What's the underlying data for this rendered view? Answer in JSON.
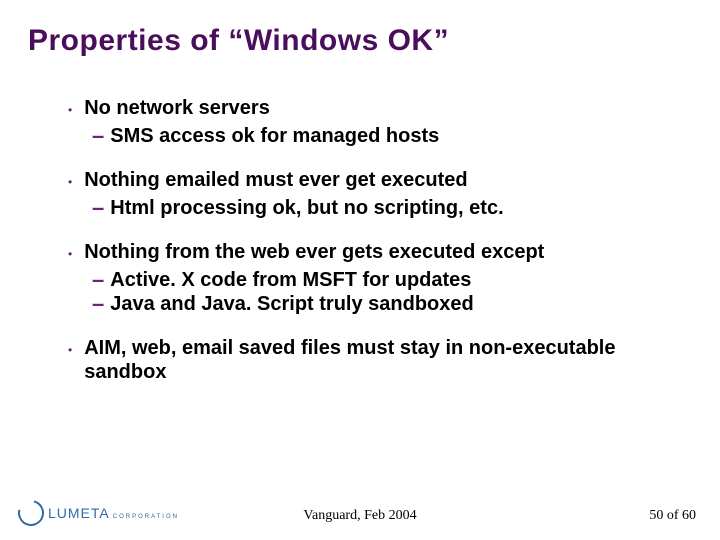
{
  "title": "Properties of “Windows OK”",
  "bullets": [
    {
      "text": "No network servers",
      "subs": [
        "SMS access ok for managed hosts"
      ]
    },
    {
      "text": "Nothing emailed must ever get executed",
      "subs": [
        "Html processing ok, but no scripting, etc."
      ]
    },
    {
      "text": "Nothing from the web ever gets executed except",
      "subs": [
        "Active. X code from MSFT for updates",
        "Java and Java. Script truly sandboxed"
      ]
    },
    {
      "text": "AIM, web, email saved files must stay in non-executable sandbox",
      "subs": []
    }
  ],
  "logo": {
    "name": "LUMETA",
    "sub": "CORPORATION"
  },
  "footer": {
    "center": "Vanguard, Feb 2004",
    "page": "50",
    "of_word": "of",
    "total": "60"
  }
}
